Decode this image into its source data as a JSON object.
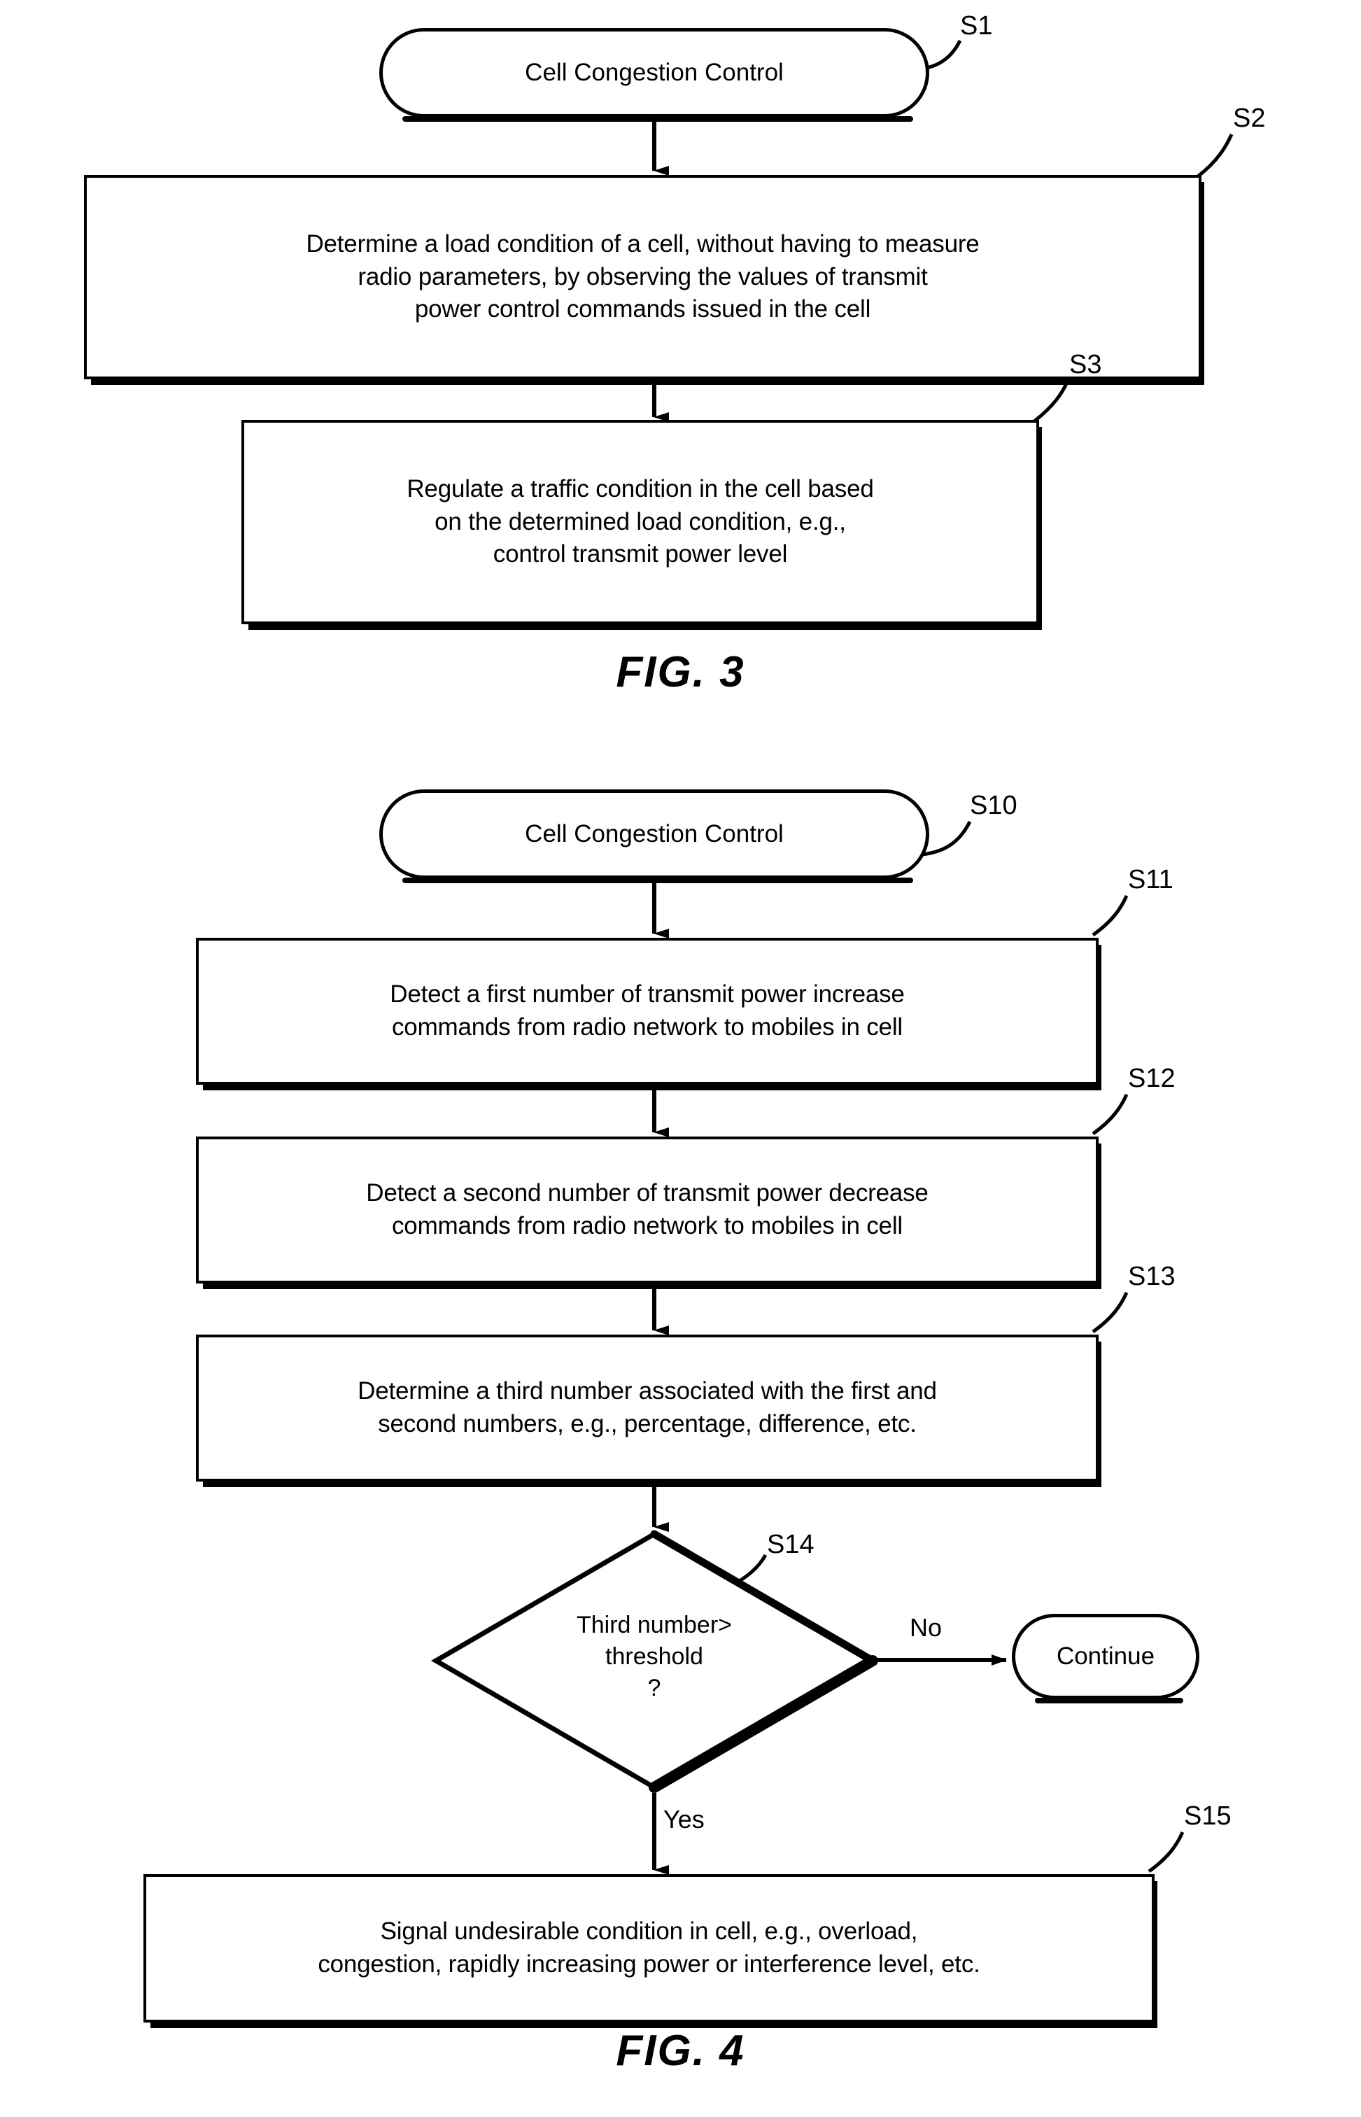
{
  "document": {
    "type": "patent-drawing-sheet",
    "figures": [
      "FIG. 3",
      "FIG. 4"
    ]
  },
  "fig3": {
    "caption": "FIG. 3",
    "nodes": {
      "start": {
        "ref": "S1",
        "shape": "terminator",
        "label": "Cell Congestion Control"
      },
      "s2": {
        "ref": "S2",
        "shape": "process",
        "label": "Determine a load condition of a cell, without having to measure\nradio parameters, by observing the values of transmit\npower control commands issued in the cell"
      },
      "s3": {
        "ref": "S3",
        "shape": "process",
        "label": "Regulate a traffic condition in the cell based\non the determined load condition, e.g.,\ncontrol transmit power level"
      }
    },
    "edges": [
      {
        "from": "S1",
        "to": "S2",
        "label": ""
      },
      {
        "from": "S2",
        "to": "S3",
        "label": ""
      }
    ]
  },
  "fig4": {
    "caption": "FIG. 4",
    "nodes": {
      "start": {
        "ref": "S10",
        "shape": "terminator",
        "label": "Cell Congestion Control"
      },
      "s11": {
        "ref": "S11",
        "shape": "process",
        "label": "Detect a first number of transmit power increase\ncommands from radio network to mobiles in cell"
      },
      "s12": {
        "ref": "S12",
        "shape": "process",
        "label": "Detect a second number of transmit power decrease\ncommands from radio network to mobiles in cell"
      },
      "s13": {
        "ref": "S13",
        "shape": "process",
        "label": "Determine a third number associated with the first and\nsecond numbers, e.g., percentage, difference, etc."
      },
      "s14": {
        "ref": "S14",
        "shape": "decision",
        "label": "Third number>\nthreshold\n?"
      },
      "continue": {
        "ref": "",
        "shape": "terminator",
        "label": "Continue"
      },
      "s15": {
        "ref": "S15",
        "shape": "process",
        "label": "Signal undesirable condition in cell, e.g., overload,\ncongestion, rapidly increasing power or interference level, etc."
      }
    },
    "edges": [
      {
        "from": "S10",
        "to": "S11",
        "label": ""
      },
      {
        "from": "S11",
        "to": "S12",
        "label": ""
      },
      {
        "from": "S12",
        "to": "S13",
        "label": ""
      },
      {
        "from": "S13",
        "to": "S14",
        "label": ""
      },
      {
        "from": "S14",
        "to": "Continue",
        "label": "No"
      },
      {
        "from": "S14",
        "to": "S15",
        "label": "Yes"
      }
    ],
    "edge_labels": {
      "no": "No",
      "yes": "Yes"
    }
  },
  "colors": {
    "ink": "#000000",
    "paper": "#ffffff"
  }
}
